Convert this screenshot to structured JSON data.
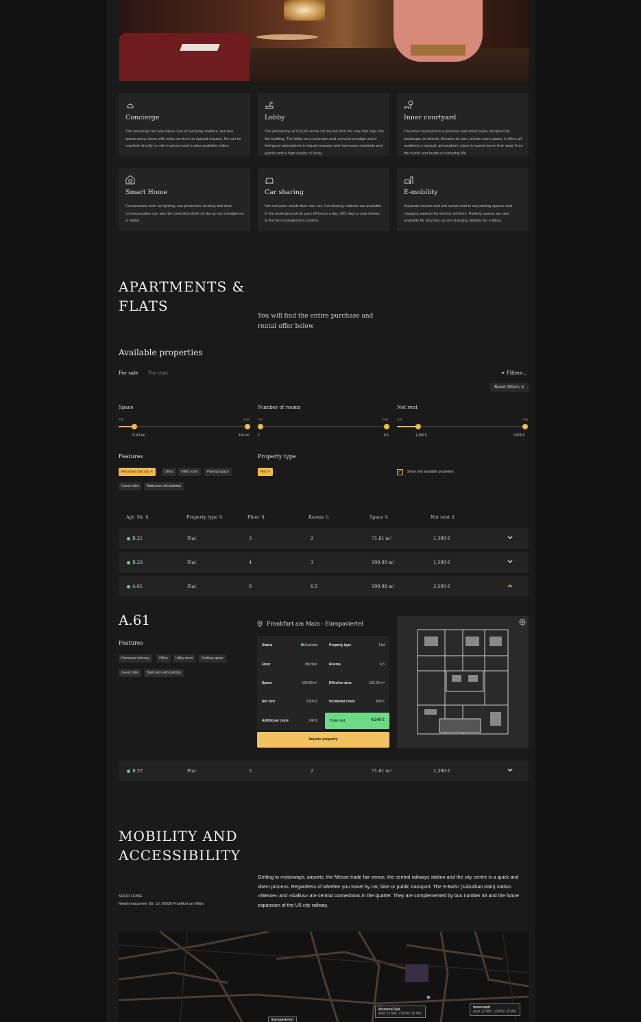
{
  "amenities": [
    {
      "icon": "bell-icon",
      "title": "Concierge",
      "desc": "The concierge not only takes care of everyday matters, but also opens many doors with extra services on special request. He can be reached directly on site in person and is also available online."
    },
    {
      "icon": "lobby-icon",
      "title": "Lobby",
      "desc": "The philosophy of SOLID Home can be felt from the very first step into the building. The lobby as a business card conveys prestige and a feel-good atmosphere in equal measure and impresses residents and guests with a high quality of living."
    },
    {
      "icon": "bench-tree-icon",
      "title": "Inner courtyard",
      "desc": "The inner courtyard is a precious and small oasis, designed by landscape architects. Besides its own, private open space, it offers all residents a tranquil, atmospheric place to spend some time away from the hustle and bustle of everyday life."
    },
    {
      "icon": "smart-home-icon",
      "title": "Smart Home",
      "desc": "Components such as lighting, sun protection, heating and door communication can also be controlled while on the go via smartphone or tablet"
    },
    {
      "icon": "car-icon",
      "title": "Car sharing",
      "desc": "Not everyone needs their own car. Car sharing vehicles are available in the underground car park 24 hours a day, 365 days a year thanks to the key management system."
    },
    {
      "icon": "ev-charging-icon",
      "title": "E-mobility",
      "desc": "Separate access and exit ramps lead to car parking spaces and charging stations for electric vehicles. Parking spaces are also available for bicycles, as are charging stations for e-bikes."
    }
  ],
  "apartments": {
    "title_line1": "APARTMENTS &",
    "title_line2": "FLATS",
    "lead": "You will find the entire purchase and rental offer below"
  },
  "available": {
    "heading": "Available properties",
    "tabs": [
      "For sale",
      "For rent"
    ],
    "filters_label": "Filters",
    "reset_label": "Reset filters",
    "sliders": [
      {
        "label": "Space",
        "min_label": "min",
        "max_label": "max",
        "low": "71.81 m²",
        "high": "191 m²",
        "low_pos": 0.12,
        "high_pos": 1.0
      },
      {
        "label": "Number of rooms",
        "min_label": "min",
        "max_label": "max",
        "low": "2",
        "high": "6.5",
        "low_pos": 0.0,
        "high_pos": 1.0
      },
      {
        "label": "Net rent",
        "min_label": "min",
        "max_label": "max",
        "low": "1,390 €",
        "high": "3,500 €",
        "low_pos": 0.17,
        "high_pos": 1.0
      }
    ],
    "features_label": "Features",
    "features": [
      {
        "label": "Recessed balcony",
        "on": true
      },
      {
        "label": "Office",
        "on": false
      },
      {
        "label": "Utility room",
        "on": false
      },
      {
        "label": "Parking space",
        "on": false
      },
      {
        "label": "Guest toilet",
        "on": false
      },
      {
        "label": "Bathroom with bathtub",
        "on": false
      }
    ],
    "ptype_label": "Property type",
    "ptype_chip": "Flat",
    "only_available": "Show only available properties"
  },
  "table": {
    "headers": [
      "Apt. Nr.",
      "Property type",
      "Floor",
      "Rooms",
      "Space",
      "Net rent"
    ],
    "rows": [
      {
        "apt": "B.21",
        "type": "Flat",
        "floor": "3",
        "rooms": "2",
        "space": "71.81 m²",
        "rent": "1,390 €"
      },
      {
        "apt": "B.28",
        "type": "Flat",
        "floor": "4",
        "rooms": "3",
        "space": "100.90 m²",
        "rent": "1,590 €"
      },
      {
        "apt": "A.61",
        "type": "Flat",
        "floor": "9",
        "rooms": "6.5",
        "space": "190.98 m²",
        "rent": "3,500 €"
      }
    ],
    "last_row": {
      "apt": "B.37",
      "type": "Flat",
      "floor": "5",
      "rooms": "2",
      "space": "71.81 m²",
      "rent": "1,390 €"
    }
  },
  "detail": {
    "name": "A.61",
    "features_label": "Features",
    "features": [
      "Recessed balcony",
      "Office",
      "Utility room",
      "Parking space",
      "Guest toilet",
      "Bathroom with bathtub"
    ],
    "location": "Frankfurt am Main - Europaviertel",
    "status_k": "Status",
    "status_v": "Available",
    "ptype_k": "Property type",
    "ptype_v": "Flat",
    "floor_k": "Floor",
    "floor_v": "9th floor",
    "rooms_k": "Rooms",
    "rooms_v": "6.5",
    "space_k": "Space",
    "space_v": "190.98 m²",
    "earea_k": "Effective area",
    "earea_v": "192.32 m²",
    "net_k": "Net rent",
    "net_v": "3,500 €",
    "inc_k": "Incidental costs",
    "inc_v": "800 €",
    "add_k": "Additional costs",
    "add_v": "240 €",
    "total_k": "Total rent",
    "total_v": "4,540 €",
    "inquire": "Inquire property"
  },
  "mobility": {
    "title_line1": "MOBILITY AND",
    "title_line2": "ACCESSIBILITY",
    "company": "SOLID HOME",
    "address": "Niedernhausener Str. 13, 60326 Frankfurt am Main",
    "text": "Getting to motorways, airports, the Messe trade fair venue, the central railways station and the city centre is a quick and direct process. Regardless of whether you travel by car, bike or public transport. The S-Bahn (suburban train) station «Messe» and «Gallus» are central connections in the quarter. They are complemented by bus number 46 and the future expansion of the U5 city railway."
  },
  "map": {
    "westend": "Westend Süd",
    "westend_sub": "Auto 10 Min. | ÖPNV 18 Min.",
    "innenstadt": "Innenstadt",
    "innenstadt_sub": "Auto 12 Min. | ÖPNV 18 Min.",
    "europaviertel": "Europaviertel"
  },
  "colors": {
    "accent": "#f2b94f",
    "available": "#5fd27a",
    "total": "#6ddb85",
    "background": "#1a1a1a"
  }
}
